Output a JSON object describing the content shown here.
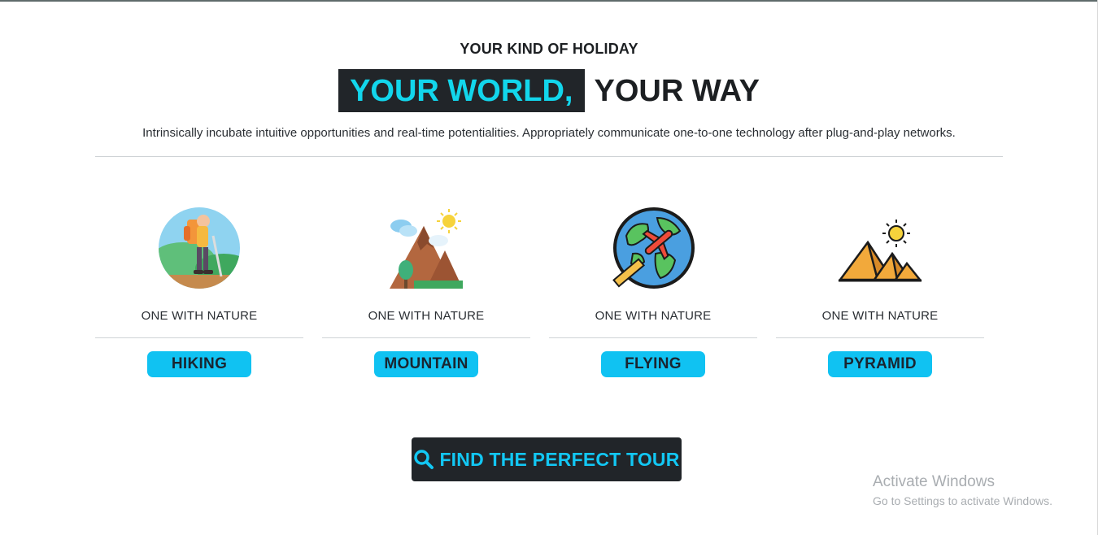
{
  "hero": {
    "kicker": "YOUR KIND OF HOLIDAY",
    "headline_highlight": "YOUR WORLD,",
    "headline_rest": "YOUR WAY",
    "intro": "Intrinsically incubate intuitive opportunities and real-time potentialities. Appropriately communicate one-to-one technology after plug-and-play networks."
  },
  "categories": [
    {
      "caption": "ONE WITH NATURE",
      "tag": "HIKING",
      "icon": "hiker-icon"
    },
    {
      "caption": "ONE WITH NATURE",
      "tag": "MOUNTAIN",
      "icon": "mountain-icon"
    },
    {
      "caption": "ONE WITH NATURE",
      "tag": "FLYING",
      "icon": "globe-plane-icon"
    },
    {
      "caption": "ONE WITH NATURE",
      "tag": "PYRAMID",
      "icon": "pyramid-icon"
    }
  ],
  "cta": {
    "label": "FIND THE PERFECT TOUR",
    "icon": "search-icon"
  },
  "watermark": {
    "title": "Activate Windows",
    "subtitle": "Go to Settings to activate Windows."
  },
  "colors": {
    "accent": "#12d6ec",
    "tag_bg": "#10c2f2",
    "dark": "#212529"
  }
}
